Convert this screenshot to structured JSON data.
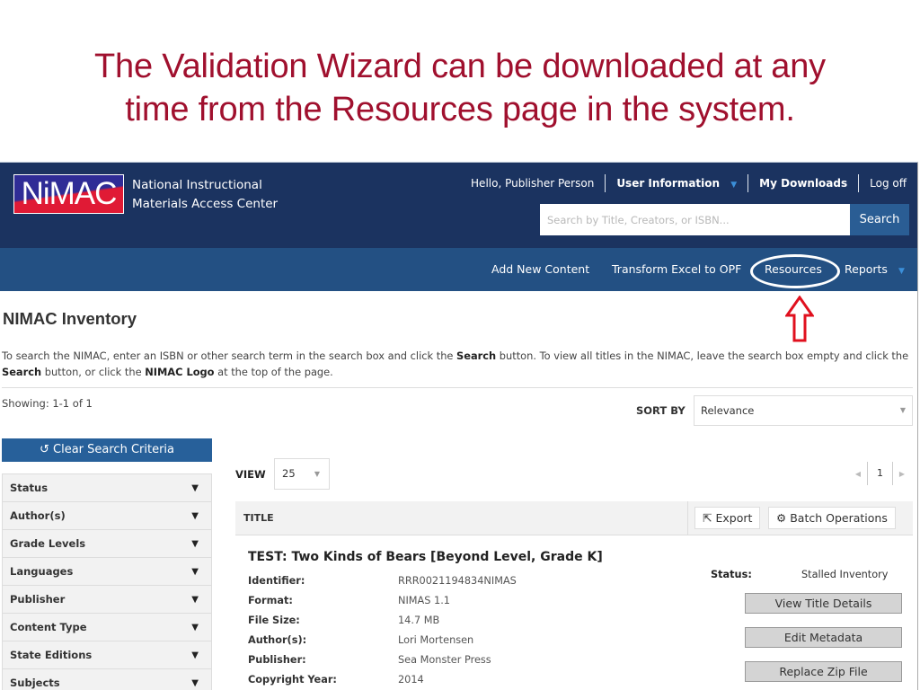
{
  "slide": {
    "title_line1": "The Validation Wizard can be downloaded at any",
    "title_line2": "time from the Resources page in the system."
  },
  "header": {
    "logo_text": "NiMAC",
    "org_name_line1": "National Instructional",
    "org_name_line2": "Materials Access Center",
    "greeting": "Hello, Publisher Person",
    "user_info_label": "User Information",
    "my_downloads_label": "My Downloads",
    "logoff_label": "Log off",
    "search_placeholder": "Search by Title, Creators, or ISBN...",
    "search_value": "",
    "search_button": "Search"
  },
  "nav": {
    "items": [
      {
        "label": "Add New Content"
      },
      {
        "label": "Transform Excel to OPF"
      },
      {
        "label": "Resources"
      },
      {
        "label": "Reports"
      }
    ],
    "highlighted": "Resources"
  },
  "annotation": {
    "ellipse_color": "#ffffff",
    "arrow_color": "#e0101e"
  },
  "page": {
    "title": "NIMAC Inventory",
    "intro": {
      "p1": "To search the NIMAC, enter an ISBN or other search term in the search box and click the ",
      "b1": "Search",
      "p2": " button. To view all titles in the NIMAC, leave the search box empty and click the ",
      "b2": "Search",
      "p3": " button, or click the ",
      "b3": "NIMAC Logo",
      "p4": " at the top of the page."
    },
    "showing": "Showing: 1-1 of 1",
    "sort_by_label": "SORT BY",
    "sort_by_value": "Relevance"
  },
  "sidebar": {
    "clear_button": "Clear Search Criteria",
    "facets": [
      {
        "label": "Status"
      },
      {
        "label": "Author(s)"
      },
      {
        "label": "Grade Levels"
      },
      {
        "label": "Languages"
      },
      {
        "label": "Publisher"
      },
      {
        "label": "Content Type"
      },
      {
        "label": "State Editions"
      },
      {
        "label": "Subjects"
      }
    ]
  },
  "results": {
    "view_label": "VIEW",
    "view_value": "25",
    "pagination": {
      "current_page": "1"
    },
    "column_title": "TITLE",
    "export_button": "Export",
    "batch_button": "Batch Operations",
    "items": [
      {
        "title": "TEST: Two Kinds of Bears [Beyond Level, Grade K]",
        "fields": [
          {
            "label": "Identifier:",
            "value": "RRR0021194834NIMAS"
          },
          {
            "label": "Format:",
            "value": "NIMAS 1.1"
          },
          {
            "label": "File Size:",
            "value": "14.7 MB"
          },
          {
            "label": "Author(s):",
            "value": "Lori Mortensen"
          },
          {
            "label": "Publisher:",
            "value": "Sea Monster Press"
          },
          {
            "label": "Copyright Year:",
            "value": "2014"
          }
        ],
        "status_label": "Status:",
        "status_value": "Stalled Inventory",
        "actions": [
          {
            "label": "View Title Details"
          },
          {
            "label": "Edit Metadata"
          },
          {
            "label": "Replace Zip File"
          }
        ]
      }
    ]
  }
}
